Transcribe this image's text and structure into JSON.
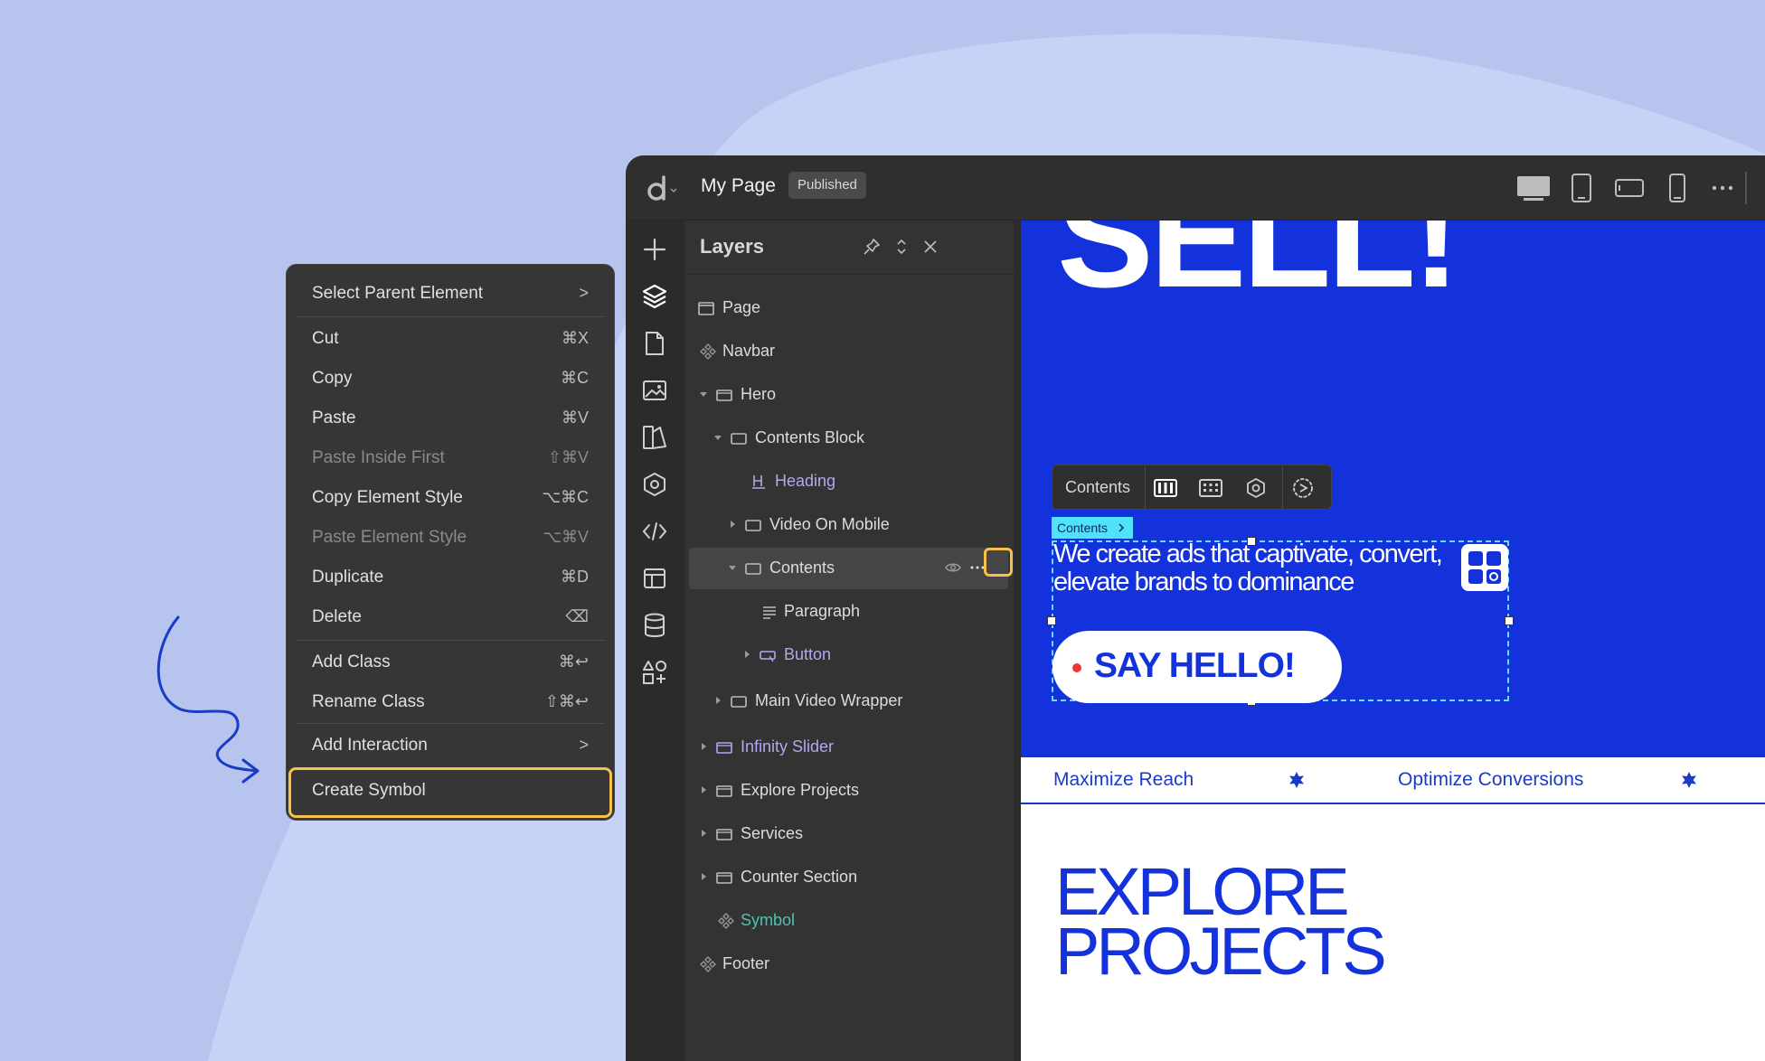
{
  "colors": {
    "accent_blue": "#1432dc",
    "highlight": "#f6c04a",
    "panel": "#333333",
    "menu": "#363636"
  },
  "topbar": {
    "page_title": "My Page",
    "status": "Published",
    "devices": [
      "desktop-icon",
      "tablet-icon",
      "tablet-landscape-icon",
      "mobile-icon",
      "more-icon"
    ]
  },
  "rail": [
    "add-icon",
    "layers-icon",
    "pages-icon",
    "media-icon",
    "style-icon",
    "symbols-icon",
    "code-icon",
    "layout-icon",
    "database-icon",
    "apps-icon"
  ],
  "layers": {
    "title": "Layers",
    "items": [
      {
        "label": "Page",
        "icon": "page-icon",
        "style": "default"
      },
      {
        "label": "Navbar",
        "icon": "symbol-icon",
        "style": "default"
      },
      {
        "label": "Hero",
        "icon": "section-icon",
        "style": "default"
      },
      {
        "label": "Contents Block",
        "icon": "box-icon",
        "style": "default"
      },
      {
        "label": "Heading",
        "icon": "heading-icon",
        "style": "purple"
      },
      {
        "label": "Video On Mobile",
        "icon": "box-icon",
        "style": "default"
      },
      {
        "label": "Contents",
        "icon": "box-icon",
        "style": "default"
      },
      {
        "label": "Paragraph",
        "icon": "paragraph-icon",
        "style": "default"
      },
      {
        "label": "Button",
        "icon": "button-icon",
        "style": "purple"
      },
      {
        "label": "Main Video Wrapper",
        "icon": "box-icon",
        "style": "default"
      },
      {
        "label": "Infinity Slider",
        "icon": "section-icon",
        "style": "purple"
      },
      {
        "label": "Explore Projects",
        "icon": "section-icon",
        "style": "default"
      },
      {
        "label": "Services",
        "icon": "section-icon",
        "style": "default"
      },
      {
        "label": "Counter Section",
        "icon": "section-icon",
        "style": "default"
      },
      {
        "label": "Symbol",
        "icon": "symbol-icon",
        "style": "teal"
      },
      {
        "label": "Footer",
        "icon": "symbol-icon",
        "style": "default"
      }
    ]
  },
  "context_menu": {
    "items": [
      {
        "label": "Select Parent Element",
        "shortcut": ">",
        "disabled": false
      },
      {
        "label": "Cut",
        "shortcut": "⌘X",
        "disabled": false
      },
      {
        "label": "Copy",
        "shortcut": "⌘C",
        "disabled": false
      },
      {
        "label": "Paste",
        "shortcut": "⌘V",
        "disabled": false
      },
      {
        "label": "Paste Inside First",
        "shortcut": "⇧⌘V",
        "disabled": true
      },
      {
        "label": "Copy Element Style",
        "shortcut": "⌥⌘C",
        "disabled": false
      },
      {
        "label": "Paste Element Style",
        "shortcut": "⌥⌘V",
        "disabled": true
      },
      {
        "label": "Duplicate",
        "shortcut": "⌘D",
        "disabled": false
      },
      {
        "label": "Delete",
        "shortcut": "⌫",
        "disabled": false
      },
      {
        "label": "Add Class",
        "shortcut": "⌘↩",
        "disabled": false
      },
      {
        "label": "Rename Class",
        "shortcut": "⇧⌘↩",
        "disabled": false
      },
      {
        "label": "Add Interaction",
        "shortcut": ">",
        "disabled": false
      },
      {
        "label": "Create Symbol",
        "shortcut": "",
        "disabled": false
      }
    ]
  },
  "canvas": {
    "hero_heading": "SELL!",
    "toolbar_label": "Contents",
    "tag_label": "Contents",
    "hero_paragraph": "We create ads that captivate, convert, elevate brands to dominance",
    "cta_label": "SAY HELLO!",
    "ticker": [
      "Maximize Reach",
      "Optimize Conversions"
    ],
    "explore_line1": "EXPLORE",
    "explore_line2": "PROJECTS"
  }
}
